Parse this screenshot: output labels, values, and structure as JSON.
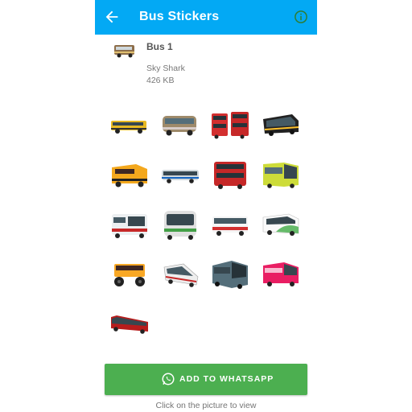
{
  "app_bar": {
    "title": "Bus Stickers",
    "back_icon": "arrow-left-icon",
    "info_icon": "info-circle-icon",
    "color": "#03a9f4"
  },
  "pack": {
    "name": "Bus 1",
    "publisher": "Sky Shark",
    "size": "426 KB",
    "tray_icon": "bus-icon"
  },
  "stickers": [
    {
      "name": "yellow-school-bus-side"
    },
    {
      "name": "vintage-bus"
    },
    {
      "name": "red-double-decker-pair"
    },
    {
      "name": "black-coach-bus"
    },
    {
      "name": "orange-school-bus-front"
    },
    {
      "name": "silver-coach-bus"
    },
    {
      "name": "red-double-decker"
    },
    {
      "name": "yellow-city-bus-front"
    },
    {
      "name": "white-red-bus-front"
    },
    {
      "name": "white-green-bus-front"
    },
    {
      "name": "white-red-city-bus"
    },
    {
      "name": "white-green-coach"
    },
    {
      "name": "monster-school-bus"
    },
    {
      "name": "crashed-white-bus"
    },
    {
      "name": "grey-coach-bus-front"
    },
    {
      "name": "pink-red-coach"
    },
    {
      "name": "red-long-coach"
    }
  ],
  "add_button": {
    "label": "ADD TO WHATSAPP",
    "icon": "whatsapp-icon",
    "color": "#4caf50"
  },
  "hint_text": "Click on the picture to view"
}
